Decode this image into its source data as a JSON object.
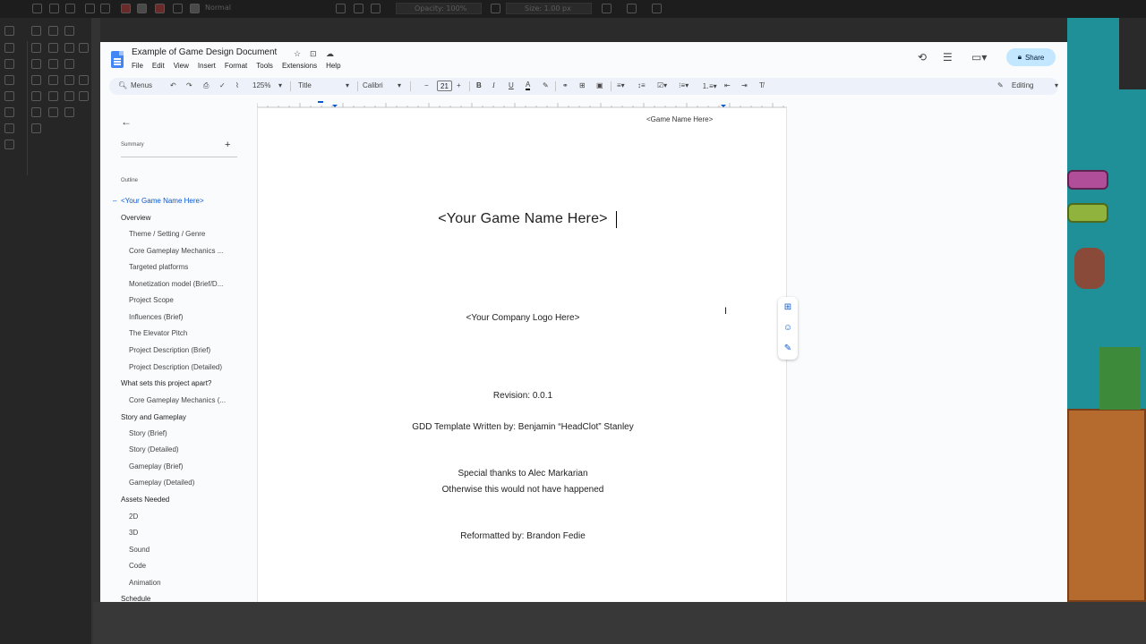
{
  "editor": {
    "mode_label": "Normal",
    "opacity_label": "Opacity: 100%",
    "size_label": "Size: 1.00 px"
  },
  "docs": {
    "title": "Example of Game Design Document",
    "menu": [
      "File",
      "Edit",
      "View",
      "Insert",
      "Format",
      "Tools",
      "Extensions",
      "Help"
    ],
    "share_label": "Share",
    "toolbar": {
      "menus_label": "Menus",
      "zoom": "125%",
      "style": "Title",
      "font": "Calibri",
      "font_size": "21",
      "mode": "Editing"
    }
  },
  "sidebar": {
    "summary_label": "Summary",
    "outline_label": "Outline",
    "items": [
      {
        "label": "<Your Game Name Here>",
        "level": 0
      },
      {
        "label": "Overview",
        "level": 1
      },
      {
        "label": "Theme / Setting / Genre",
        "level": 2
      },
      {
        "label": "Core Gameplay Mechanics ...",
        "level": 2
      },
      {
        "label": "Targeted platforms",
        "level": 2
      },
      {
        "label": "Monetization model (Brief/D...",
        "level": 2
      },
      {
        "label": "Project Scope",
        "level": 2
      },
      {
        "label": "Influences (Brief)",
        "level": 2
      },
      {
        "label": "The Elevator Pitch",
        "level": 2
      },
      {
        "label": "Project Description (Brief)",
        "level": 2
      },
      {
        "label": "Project Description (Detailed)",
        "level": 2
      },
      {
        "label": "What sets this project apart?",
        "level": 1
      },
      {
        "label": "Core Gameplay Mechanics (...",
        "level": 2
      },
      {
        "label": "Story and Gameplay",
        "level": 1
      },
      {
        "label": "Story (Brief)",
        "level": 2
      },
      {
        "label": "Story (Detailed)",
        "level": 2
      },
      {
        "label": "Gameplay (Brief)",
        "level": 2
      },
      {
        "label": "Gameplay (Detailed)",
        "level": 2
      },
      {
        "label": "Assets Needed",
        "level": 1
      },
      {
        "label": "2D",
        "level": 2
      },
      {
        "label": "3D",
        "level": 2
      },
      {
        "label": "Sound",
        "level": 2
      },
      {
        "label": "Code",
        "level": 2
      },
      {
        "label": "Animation",
        "level": 2
      },
      {
        "label": "Schedule",
        "level": 1
      }
    ]
  },
  "page": {
    "header_text": "<Game Name Here>",
    "title": "<Your Game Name Here>",
    "logo_placeholder": "<Your Company Logo Here>",
    "revision": "Revision: 0.0.1",
    "written_by": "GDD Template Written by: Benjamin “HeadClot” Stanley",
    "thanks_1": "Special thanks to Alec Markarian",
    "thanks_2": "Otherwise this would not have happened",
    "reformatted_by": "Reformatted by: Brandon Fedie"
  },
  "colors": {
    "accent": "#0b57d0",
    "share_bg": "#c2e7ff",
    "teal_bg": "#1f8f98"
  }
}
